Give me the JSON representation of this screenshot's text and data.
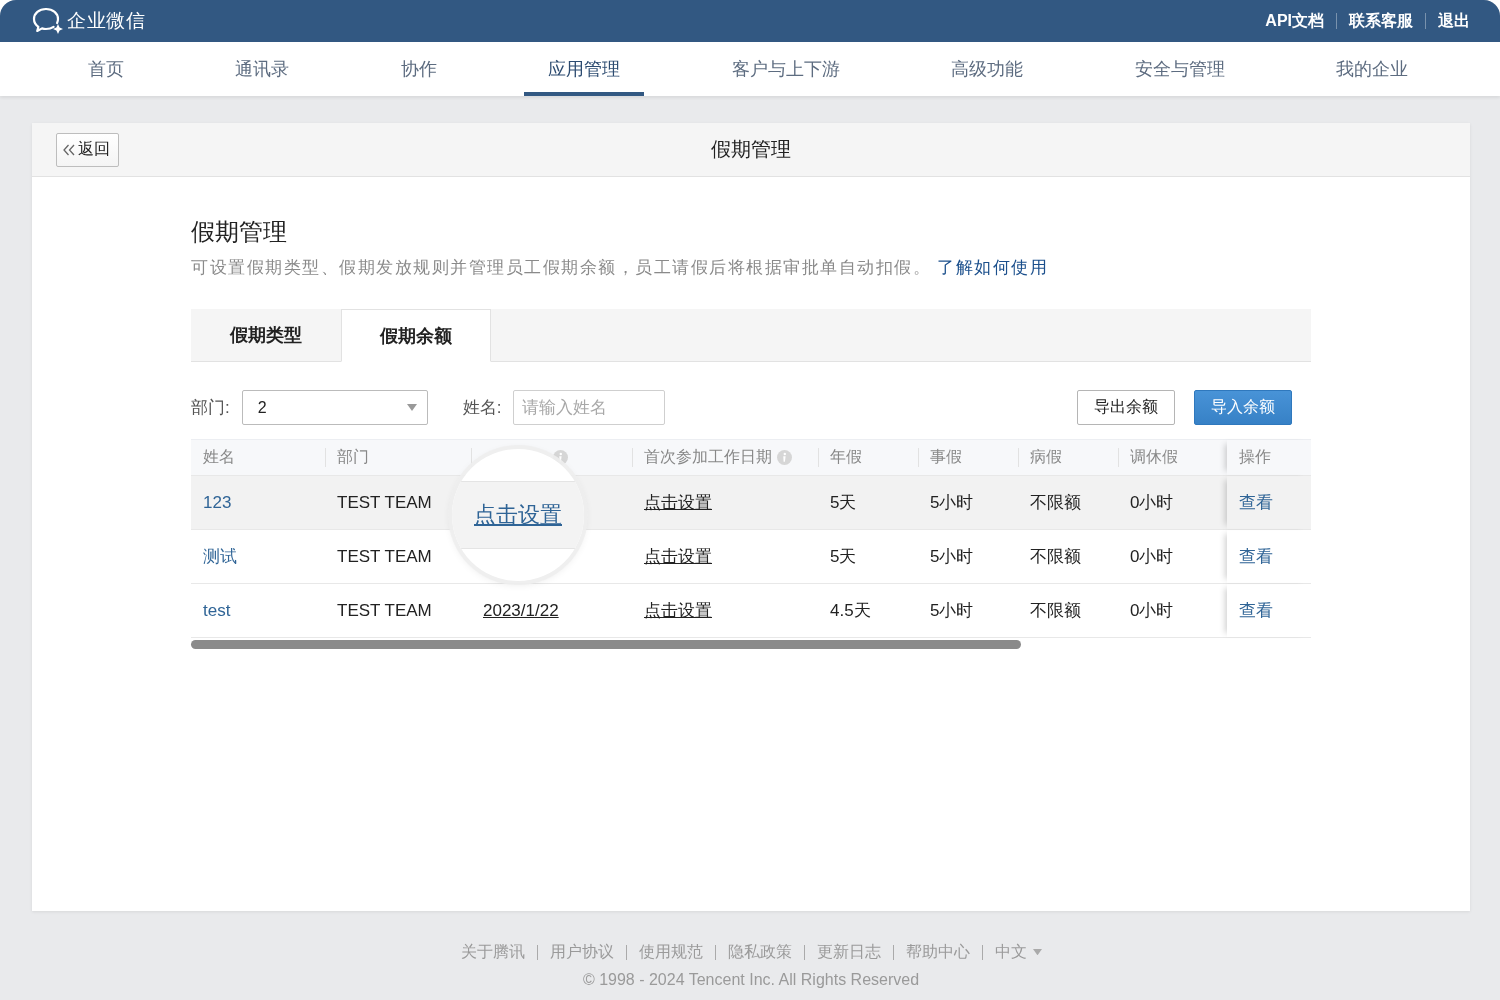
{
  "top_bar": {
    "logo": "企业微信",
    "links": [
      "API文档",
      "联系客服",
      "退出"
    ]
  },
  "nav": [
    {
      "label": "首页",
      "selected": false
    },
    {
      "label": "通讯录",
      "selected": false
    },
    {
      "label": "协作",
      "selected": false
    },
    {
      "label": "应用管理",
      "selected": true
    },
    {
      "label": "客户与上下游",
      "selected": false
    },
    {
      "label": "高级功能",
      "selected": false
    },
    {
      "label": "安全与管理",
      "selected": false
    },
    {
      "label": "我的企业",
      "selected": false
    }
  ],
  "card": {
    "back": "返回",
    "title": "假期管理"
  },
  "intro": {
    "heading": "假期管理",
    "description": "可设置假期类型、假期发放规则并管理员工假期余额，员工请假后将根据审批单自动扣假。",
    "link": "了解如何使用"
  },
  "tabs": [
    {
      "label": "假期类型",
      "selected": false
    },
    {
      "label": "假期余额",
      "selected": true
    }
  ],
  "filters": {
    "department": {
      "label": "部门:",
      "value": "2"
    },
    "name": {
      "label": "姓名:",
      "placeholder": "请输入姓名"
    }
  },
  "actions": [
    {
      "label": "导出余额",
      "kind": "secondary"
    },
    {
      "label": "导入余额",
      "kind": "primary"
    }
  ],
  "table": {
    "columns": [
      {
        "label": "姓名",
        "info": false
      },
      {
        "label": "部门",
        "info": false
      },
      {
        "info": true
      },
      {
        "label": "首次参加工作日期",
        "info": true
      },
      {
        "label": "年假",
        "info": false
      },
      {
        "label": "事假",
        "info": false
      },
      {
        "label": "病假",
        "info": false
      },
      {
        "label": "调休假",
        "info": false
      },
      {
        "label": "操作",
        "info": false
      }
    ],
    "rows": [
      {
        "highlighted": true,
        "name": "123",
        "department": "TEST TEAM",
        "entry_date": "点击设置",
        "magnified": true,
        "first_work_date": "点击设置",
        "annual_leave": "5天",
        "personal_leave": "5小时",
        "sick_leave": "不限额",
        "compensatory_leave": "0小时",
        "action": "查看"
      },
      {
        "highlighted": false,
        "name": "测试",
        "department": "TEST TEAM",
        "magnified": false,
        "first_work_date": "点击设置",
        "annual_leave": "5天",
        "personal_leave": "5小时",
        "sick_leave": "不限额",
        "compensatory_leave": "0小时",
        "action": "查看"
      },
      {
        "highlighted": false,
        "name": "test",
        "department": "TEST TEAM",
        "entry_date": "2023/1/22",
        "magnified": false,
        "first_work_date": "点击设置",
        "annual_leave": "4.5天",
        "personal_leave": "5小时",
        "sick_leave": "不限额",
        "compensatory_leave": "0小时",
        "action": "查看"
      }
    ]
  },
  "footer": {
    "links": [
      "关于腾讯",
      "用户协议",
      "使用规范",
      "隐私政策",
      "更新日志",
      "帮助中心"
    ],
    "language": {
      "label": "中文",
      "expanded": false
    },
    "copyright": "© 1998 - 2024 Tencent Inc. All Rights Reserved"
  }
}
